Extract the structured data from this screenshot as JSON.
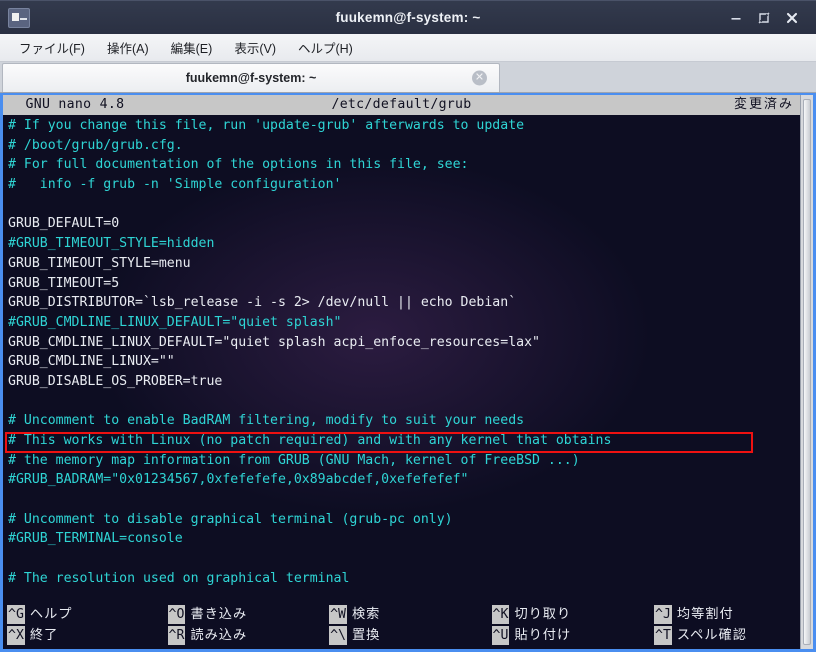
{
  "window": {
    "title": "fuukemn@f-system: ~",
    "icon": "terminal-icon",
    "controls": {
      "minimize": "−",
      "maximize": "❐",
      "close": "✕"
    }
  },
  "menubar": {
    "items": [
      {
        "label": "ファイル(F)",
        "name": "menu-file"
      },
      {
        "label": "操作(A)",
        "name": "menu-actions"
      },
      {
        "label": "編集(E)",
        "name": "menu-edit"
      },
      {
        "label": "表示(V)",
        "name": "menu-view"
      },
      {
        "label": "ヘルプ(H)",
        "name": "menu-help"
      }
    ]
  },
  "tabbar": {
    "tab_label": "fuukemn@f-system: ~",
    "close_glyph": "✕"
  },
  "nano": {
    "header": {
      "version": "  GNU nano 4.8",
      "filename": "/etc/default/grub",
      "status": "変更済み"
    },
    "lines": [
      {
        "text": "# If you change this file, run 'update-grub' afterwards to update",
        "type": "comment"
      },
      {
        "text": "# /boot/grub/grub.cfg.",
        "type": "comment"
      },
      {
        "text": "# For full documentation of the options in this file, see:",
        "type": "comment"
      },
      {
        "text": "#   info -f grub -n 'Simple configuration'",
        "type": "comment"
      },
      {
        "text": "",
        "type": "blank"
      },
      {
        "text": "GRUB_DEFAULT=0",
        "type": "plain"
      },
      {
        "text": "#GRUB_TIMEOUT_STYLE=hidden",
        "type": "comment"
      },
      {
        "text": "GRUB_TIMEOUT_STYLE=menu",
        "type": "plain"
      },
      {
        "text": "GRUB_TIMEOUT=5",
        "type": "plain"
      },
      {
        "text": "GRUB_DISTRIBUTOR=`lsb_release -i -s 2> /dev/null || echo Debian`",
        "type": "plain"
      },
      {
        "text": "#GRUB_CMDLINE_LINUX_DEFAULT=\"quiet splash\"",
        "type": "comment"
      },
      {
        "text": "GRUB_CMDLINE_LINUX_DEFAULT=\"quiet splash acpi_enfoce_resources=lax\"",
        "type": "plain",
        "highlighted": true
      },
      {
        "text": "GRUB_CMDLINE_LINUX=\"\"",
        "type": "plain"
      },
      {
        "text": "GRUB_DISABLE_OS_PROBER=true",
        "type": "plain"
      },
      {
        "text": "",
        "type": "blank"
      },
      {
        "text": "# Uncomment to enable BadRAM filtering, modify to suit your needs",
        "type": "comment"
      },
      {
        "text": "# This works with Linux (no patch required) and with any kernel that obtains",
        "type": "comment"
      },
      {
        "text": "# the memory map information from GRUB (GNU Mach, kernel of FreeBSD ...)",
        "type": "comment"
      },
      {
        "text": "#GRUB_BADRAM=\"0x01234567,0xfefefefe,0x89abcdef,0xefefefef\"",
        "type": "comment"
      },
      {
        "text": "",
        "type": "blank"
      },
      {
        "text": "# Uncomment to disable graphical terminal (grub-pc only)",
        "type": "comment"
      },
      {
        "text": "#GRUB_TERMINAL=console",
        "type": "comment"
      },
      {
        "text": "",
        "type": "blank"
      },
      {
        "text": "# The resolution used on graphical terminal",
        "type": "comment"
      }
    ],
    "shortcuts": [
      [
        {
          "key": "^G",
          "label": "ヘルプ",
          "name": "shortcut-help"
        },
        {
          "key": "^X",
          "label": "終了",
          "name": "shortcut-exit"
        }
      ],
      [
        {
          "key": "^O",
          "label": "書き込み",
          "name": "shortcut-write-out"
        },
        {
          "key": "^R",
          "label": "読み込み",
          "name": "shortcut-read-file"
        }
      ],
      [
        {
          "key": "^W",
          "label": "検索",
          "name": "shortcut-where-is"
        },
        {
          "key": "^\\",
          "label": "置換",
          "name": "shortcut-replace"
        }
      ],
      [
        {
          "key": "^K",
          "label": "切り取り",
          "name": "shortcut-cut"
        },
        {
          "key": "^U",
          "label": "貼り付け",
          "name": "shortcut-paste"
        }
      ],
      [
        {
          "key": "^J",
          "label": "均等割付",
          "name": "shortcut-justify"
        },
        {
          "key": "^T",
          "label": "スペル確認",
          "name": "shortcut-spell"
        }
      ]
    ]
  },
  "colors": {
    "terminal_bg": "#0d0d22",
    "comment": "#2fd5d5",
    "text": "#e9ecf2",
    "highlight_border": "#ee1111",
    "titlebar": "#2a3042",
    "frame_accent": "#4a8ef0"
  }
}
